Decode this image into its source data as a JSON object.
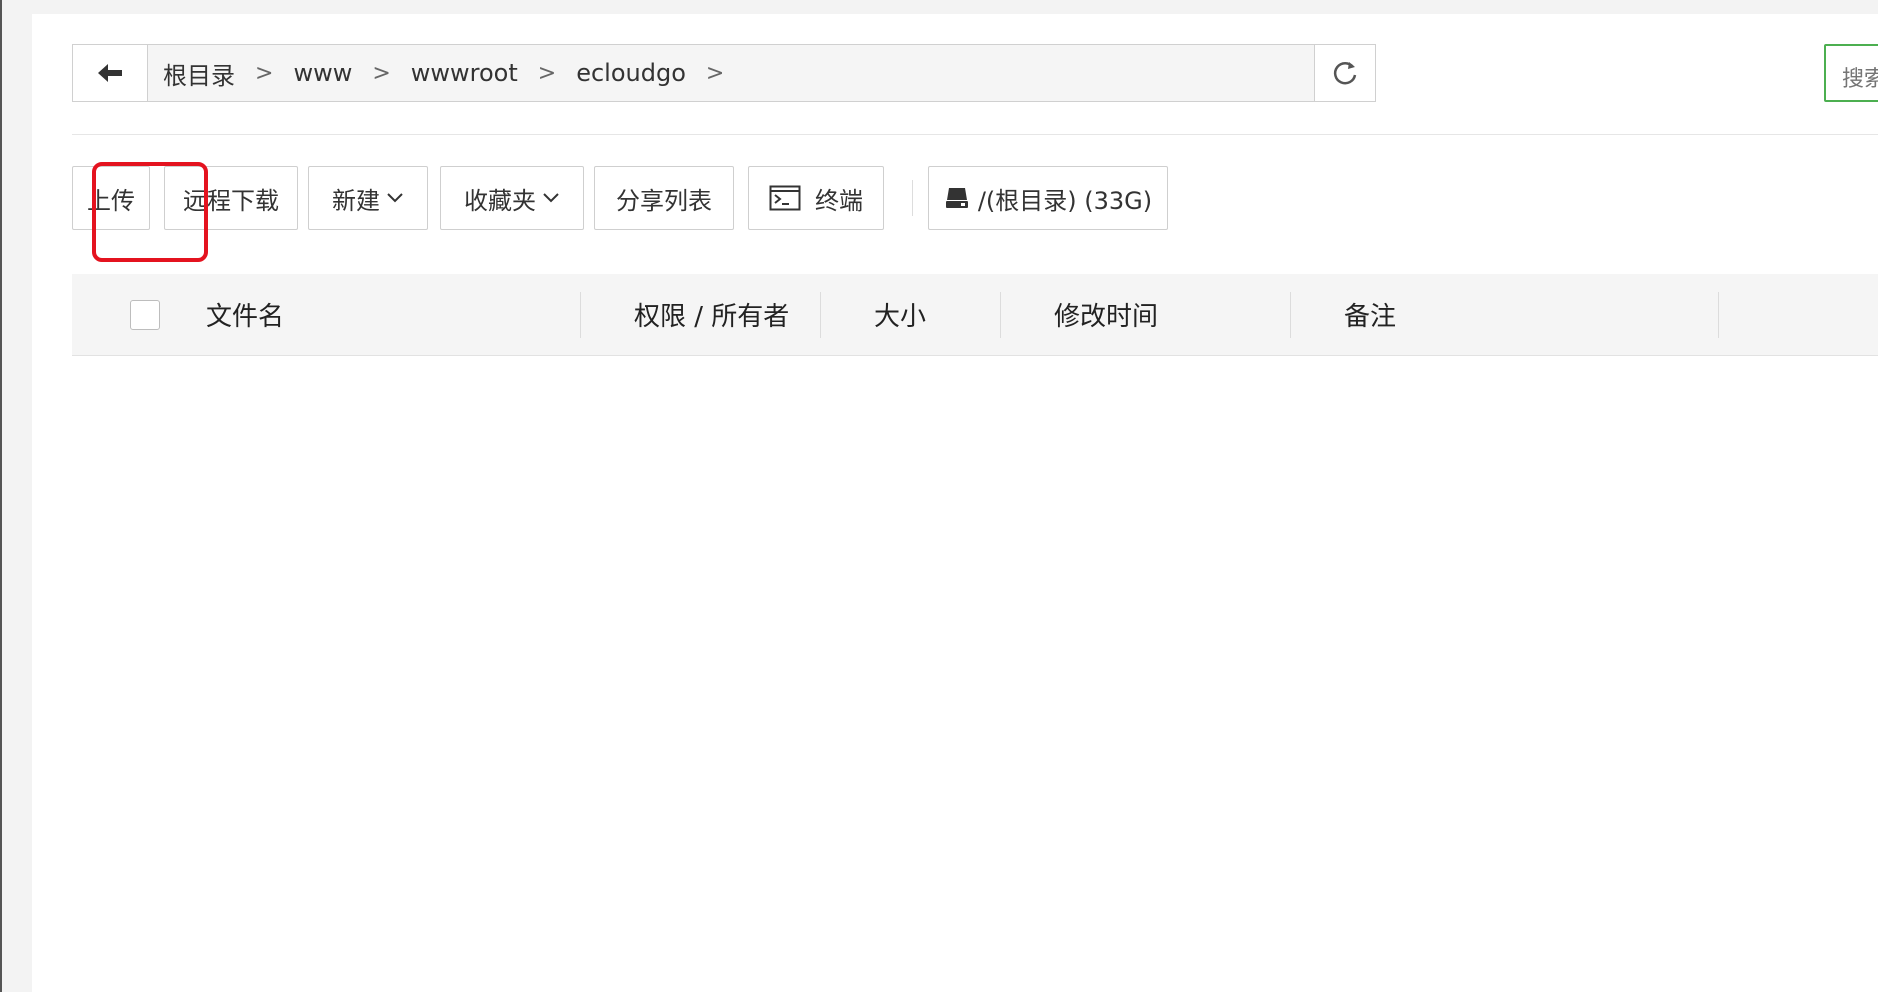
{
  "breadcrumb": {
    "items": [
      "根目录",
      "www",
      "wwwroot",
      "ecloudgo"
    ],
    "separator": ">"
  },
  "search": {
    "placeholder": "搜索"
  },
  "toolbar": {
    "upload": "上传",
    "remote_download": "远程下载",
    "new": "新建",
    "favorites": "收藏夹",
    "share_list": "分享列表",
    "terminal": "终端",
    "disk": "/(根目录) (33G)"
  },
  "table": {
    "columns": [
      "文件名",
      "权限 / 所有者",
      "大小",
      "修改时间",
      "备注"
    ]
  },
  "colors": {
    "highlight": "#e4131f",
    "search_border": "#4caf50",
    "info": "#f0a028"
  }
}
